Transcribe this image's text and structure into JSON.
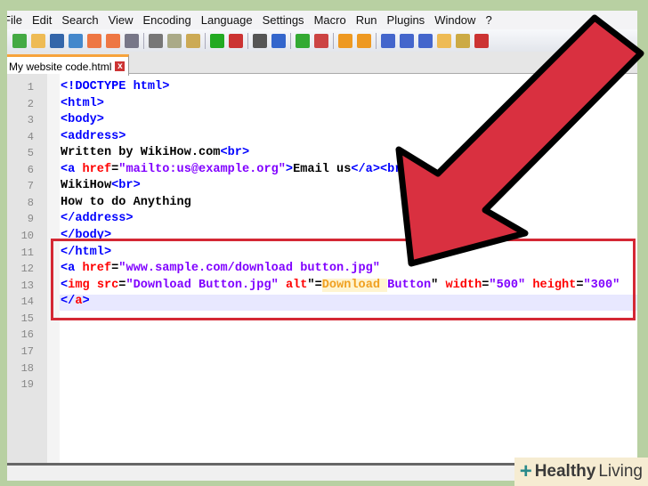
{
  "menu": [
    "File",
    "Edit",
    "Search",
    "View",
    "Encoding",
    "Language",
    "Settings",
    "Macro",
    "Run",
    "Plugins",
    "Window",
    "?"
  ],
  "tab": {
    "label": "My website code.html",
    "close": "x"
  },
  "colors": {
    "tag": "#0000ff",
    "attr": "#ff0000",
    "value": "#8000ff",
    "text": "#000000",
    "alt": "#f0a020",
    "arrow": "#d93040",
    "box": "#d42834"
  },
  "lines": [
    [
      [
        "<!DOCTYPE html>",
        "tag"
      ]
    ],
    [
      [
        "<html>",
        "tag"
      ]
    ],
    [
      [
        "<body>",
        "tag"
      ]
    ],
    [
      [
        "<address>",
        "tag"
      ]
    ],
    [
      [
        "Written by WikiHow.com",
        "text"
      ],
      [
        "<br>",
        "tag"
      ]
    ],
    [
      [
        "<a ",
        "tag"
      ],
      [
        "href",
        "attr"
      ],
      [
        "=",
        "text"
      ],
      [
        "\"mailto:us@example.org\"",
        "value"
      ],
      [
        ">",
        "tag"
      ],
      [
        "Email us",
        "text"
      ],
      [
        "</a><br>",
        "tag"
      ]
    ],
    [
      [
        "WikiHow",
        "text"
      ],
      [
        "<br>",
        "tag"
      ]
    ],
    [
      [
        "How to do Anything",
        "text"
      ]
    ],
    [
      [
        "</address>",
        "tag"
      ]
    ],
    [
      [
        "</body>",
        "tag"
      ]
    ],
    [
      [
        "</html>",
        "tag"
      ]
    ],
    [
      [
        "<a ",
        "tag"
      ],
      [
        "href",
        "attr"
      ],
      [
        "=",
        "text"
      ],
      [
        "\"www.sample.com/download button.jpg\"",
        "value"
      ]
    ],
    [
      [
        "<",
        "tag"
      ],
      [
        "img ",
        "attr"
      ],
      [
        "src",
        "attr"
      ],
      [
        "=",
        "text"
      ],
      [
        "\"Download Button.jpg\" ",
        "value"
      ],
      [
        "alt",
        "attr"
      ],
      [
        "\"=",
        "text"
      ],
      [
        "Download ",
        "alt"
      ],
      [
        "Button",
        "value"
      ],
      [
        "\" ",
        "text"
      ],
      [
        "width",
        "attr"
      ],
      [
        "=",
        "text"
      ],
      [
        "\"500\" ",
        "value"
      ],
      [
        "height",
        "attr"
      ],
      [
        "=",
        "text"
      ],
      [
        "\"300\"",
        "value"
      ]
    ],
    [
      [
        "</",
        "tag"
      ],
      [
        "a",
        "attr"
      ],
      [
        ">",
        "tag"
      ]
    ],
    [],
    [],
    [],
    [],
    []
  ],
  "watermark": {
    "brand": "Healthy",
    "suffix": "Living"
  }
}
